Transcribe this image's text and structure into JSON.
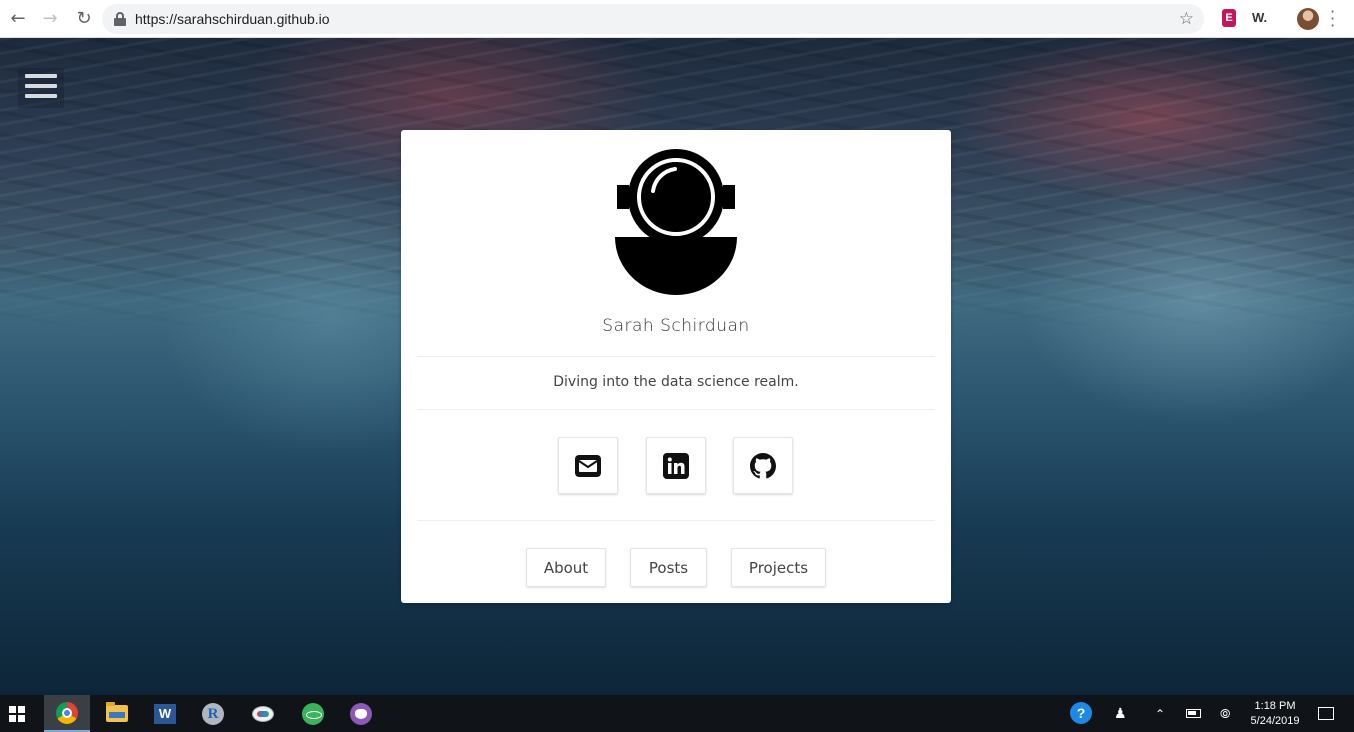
{
  "browser": {
    "url": "https://sarahschirduan.github.io",
    "back_icon": "arrow-left-icon",
    "forward_icon": "arrow-right-icon",
    "reload_icon": "reload-icon",
    "bookmark_icon": "star-icon",
    "extension_1": "E",
    "extension_2": "W.",
    "menu_icon": "more-vert-icon"
  },
  "profile": {
    "name": "Sarah Schirduan",
    "tagline": "Diving into the data science realm.",
    "social": [
      {
        "icon": "envelope-icon",
        "label": "email"
      },
      {
        "icon": "linkedin-icon",
        "label": "linkedin"
      },
      {
        "icon": "github-icon",
        "label": "github"
      }
    ],
    "nav": [
      {
        "label": "About"
      },
      {
        "label": "Posts"
      },
      {
        "label": "Projects"
      }
    ]
  },
  "taskbar": {
    "apps": [
      "windows-start-icon",
      "chrome-icon",
      "file-explorer-icon",
      "word-icon",
      "r-icon",
      "paint-icon",
      "atom-icon",
      "gitkraken-icon"
    ],
    "time": "1:18 PM",
    "date": "5/24/2019"
  },
  "colors": {
    "card_bg": "#ffffff",
    "taskbar_bg": "#101418",
    "omnibox_bg": "#f1f3f4"
  }
}
